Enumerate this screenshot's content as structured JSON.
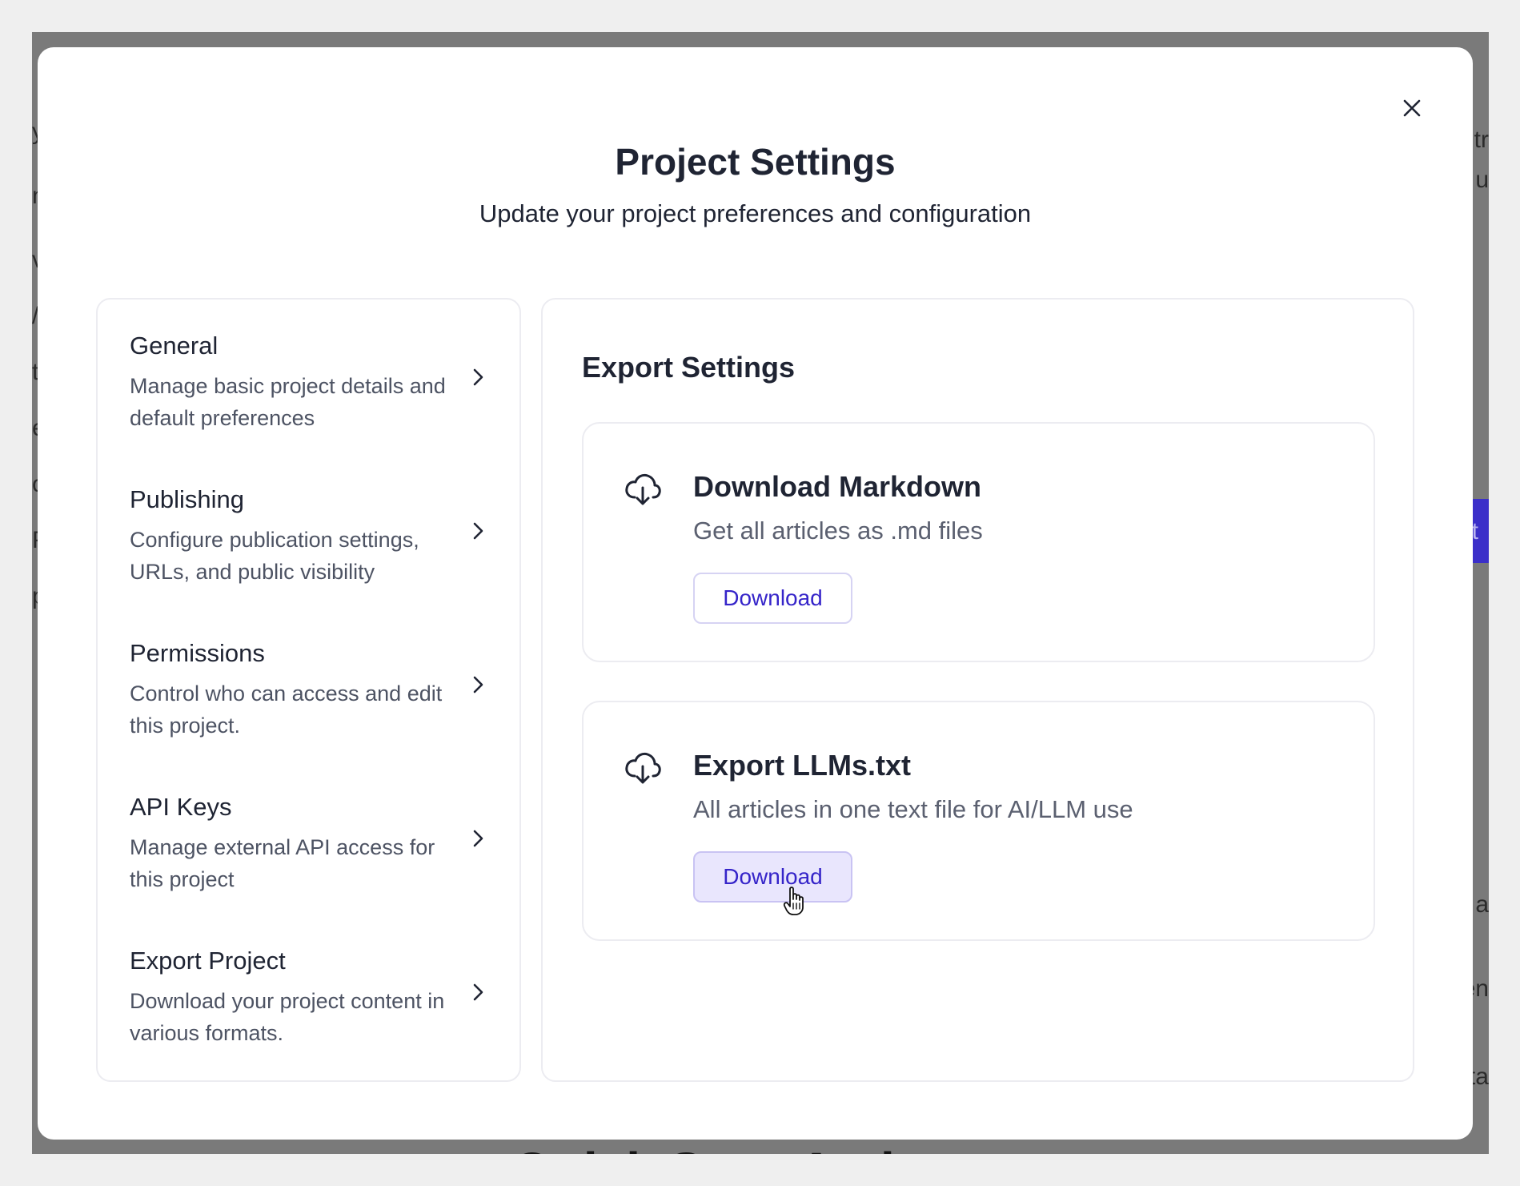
{
  "background": {
    "fragments": [
      "y",
      "n",
      "v",
      "/",
      "t",
      "e",
      "o",
      "P",
      "p",
      "tr",
      "u",
      "it",
      "a",
      "en",
      "ta"
    ],
    "heading": "Quick Start Actions"
  },
  "modal": {
    "title": "Project Settings",
    "subtitle": "Update your project preferences and configuration",
    "close_icon": "close-icon"
  },
  "nav": {
    "items": [
      {
        "label": "General",
        "description": "Manage basic project details and default preferences",
        "icon": "chevron-right-icon"
      },
      {
        "label": "Publishing",
        "description": "Configure publication settings, URLs, and public visibility",
        "icon": "chevron-right-icon"
      },
      {
        "label": "Permissions",
        "description": "Control who can access and edit this project.",
        "icon": "chevron-right-icon"
      },
      {
        "label": "API Keys",
        "description": "Manage external API access for this project",
        "icon": "chevron-right-icon"
      },
      {
        "label": "Export Project",
        "description": "Download your project content in various formats.",
        "icon": "chevron-right-icon"
      }
    ]
  },
  "export": {
    "section_title": "Export Settings",
    "options": [
      {
        "title": "Download Markdown",
        "description": "Get all articles as .md files",
        "button_label": "Download",
        "icon": "cloud-download-icon"
      },
      {
        "title": "Export LLMs.txt",
        "description": "All articles in one text file for AI/LLM use",
        "button_label": "Download",
        "icon": "cloud-download-icon",
        "state": "hover"
      }
    ]
  },
  "colors": {
    "accent": "#3524c9",
    "hover_bg": "#e9e6fd",
    "backdrop": "#7a7a7a"
  }
}
